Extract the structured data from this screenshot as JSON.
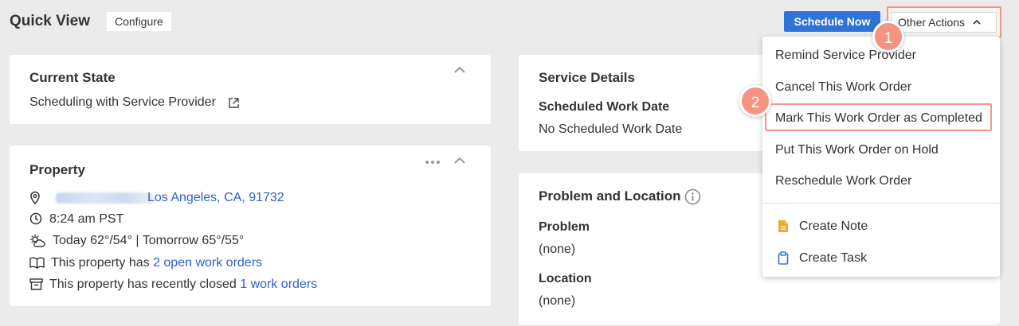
{
  "header": {
    "title": "Quick View",
    "configure_label": "Configure",
    "schedule_label": "Schedule Now",
    "other_actions_label": "Other Actions"
  },
  "current_state": {
    "title": "Current State",
    "value": "Scheduling with Service Provider"
  },
  "property": {
    "title": "Property",
    "address_city": "Los Angeles, CA, 91732",
    "time": "8:24 am PST",
    "weather": "Today 62°/54° | Tomorrow 65°/55°",
    "open_prefix": "This property has",
    "open_link": "2 open work orders",
    "closed_prefix": "This property has recently closed",
    "closed_link": "1 work orders"
  },
  "service_details": {
    "title": "Service Details",
    "scheduled_label": "Scheduled Work Date",
    "scheduled_value": "No Scheduled Work Date"
  },
  "problem_location": {
    "title": "Problem and Location",
    "problem_label": "Problem",
    "problem_value": "(none)",
    "location_label": "Location",
    "location_value": "(none)"
  },
  "dropdown": {
    "items": [
      "Remind Service Provider",
      "Cancel This Work Order",
      "Mark This Work Order as Completed",
      "Put This Work Order on Hold",
      "Reschedule Work Order"
    ],
    "create_note": "Create Note",
    "create_task": "Create Task"
  },
  "badges": [
    "1",
    "2"
  ],
  "colors": {
    "primary": "#2f73d9",
    "link": "#2a62c9",
    "highlight": "#f2978a",
    "badge": "#f59581",
    "note_icon": "#f0a830",
    "task_icon": "#2f73d9"
  }
}
